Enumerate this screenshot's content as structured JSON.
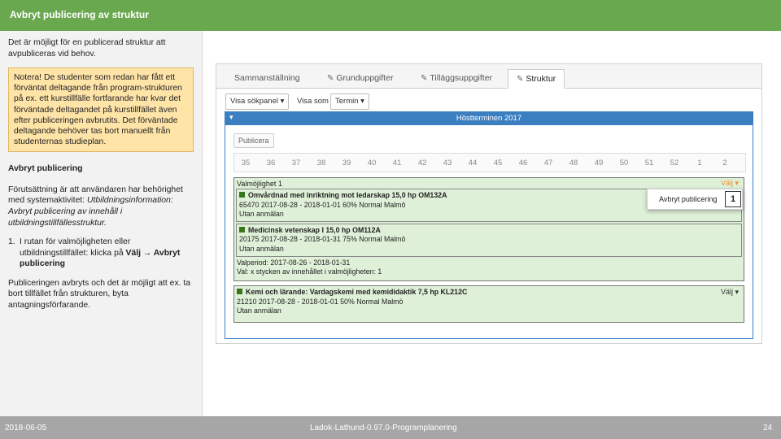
{
  "title": "Avbryt publicering av struktur",
  "left": {
    "intro": "Det är möjligt för en publicerad struktur att avpubliceras vid behov.",
    "notice": "Notera! De studenter som redan har fått ett förväntat deltagande från program-strukturen på ex. ett kurstillfälle fortfarande har kvar det förväntade deltagandet på kurstillfället även efter publiceringen avbrutits. Det förväntade deltagande behöver tas bort manuellt från studenternas studieplan.",
    "heading": "Avbryt publicering",
    "prereq_plain": "Förutsättning är att användaren har behörighet med systemaktivitet: ",
    "prereq_italic": "Utbildningsinformation: Avbryt publicering av innehåll i utbildningstillfällesstruktur.",
    "step_num": "1.",
    "step_text": "I rutan för valmöjligheten eller utbildningstillfället: klicka på ",
    "step_bold": "Välj → Avbryt publicering",
    "result": "Publiceringen avbryts och det är möjligt att ex. ta bort tillfället från strukturen, byta antagningsförfarande."
  },
  "screenshot": {
    "tabs": [
      "Sammanställning",
      "Grunduppgifter",
      "Tilläggsuppgifter",
      "Struktur"
    ],
    "view_select": "Visa sökpanel",
    "show_label": "Visa som",
    "show_select": "Termin",
    "panel_title": "Höstterminen 2017",
    "publish_button": "Publicera",
    "weeks": [
      "35",
      "36",
      "37",
      "38",
      "39",
      "40",
      "41",
      "42",
      "43",
      "44",
      "45",
      "46",
      "47",
      "48",
      "49",
      "50",
      "51",
      "52",
      "1",
      "2"
    ],
    "group1": {
      "title": "Valmöjlighet 1",
      "valj": "Välj",
      "courses": [
        {
          "name": "Omvårdnad med inriktning mot ledarskap 15,0 hp OM132A",
          "info": "65470 2017-08-28 - 2018-01-01 60% Normal Malmö",
          "status": "Utan anmälan"
        },
        {
          "name": "Medicinsk vetenskap I 15,0 hp OM112A",
          "info": "20175 2017-08-28 - 2018-01-31 75% Normal Malmö",
          "status": "Utan anmälan"
        }
      ],
      "period": "Valperiod: 2017-08-26 - 2018-01-31",
      "count": "Val: x stycken av innehållet i valmöjligheten: 1"
    },
    "group2": {
      "valj": "Välj",
      "course": {
        "name": "Kemi och lärande: Vardagskemi med kemididaktik 7,5 hp KL212C",
        "info": "21210 2017-08-28 - 2018-01-01 50% Normal Malmö",
        "status": "Utan anmälan"
      }
    },
    "popup": "Avbryt publicering",
    "marker": "1"
  },
  "footer": {
    "date": "2018-06-05",
    "center": "Ladok-Lathund-0.97.0-Programplanering",
    "page": "24"
  },
  "colors": {
    "accent": "#6aa84f",
    "panel": "#3c7fc1",
    "notice": "#ffe4a8"
  }
}
